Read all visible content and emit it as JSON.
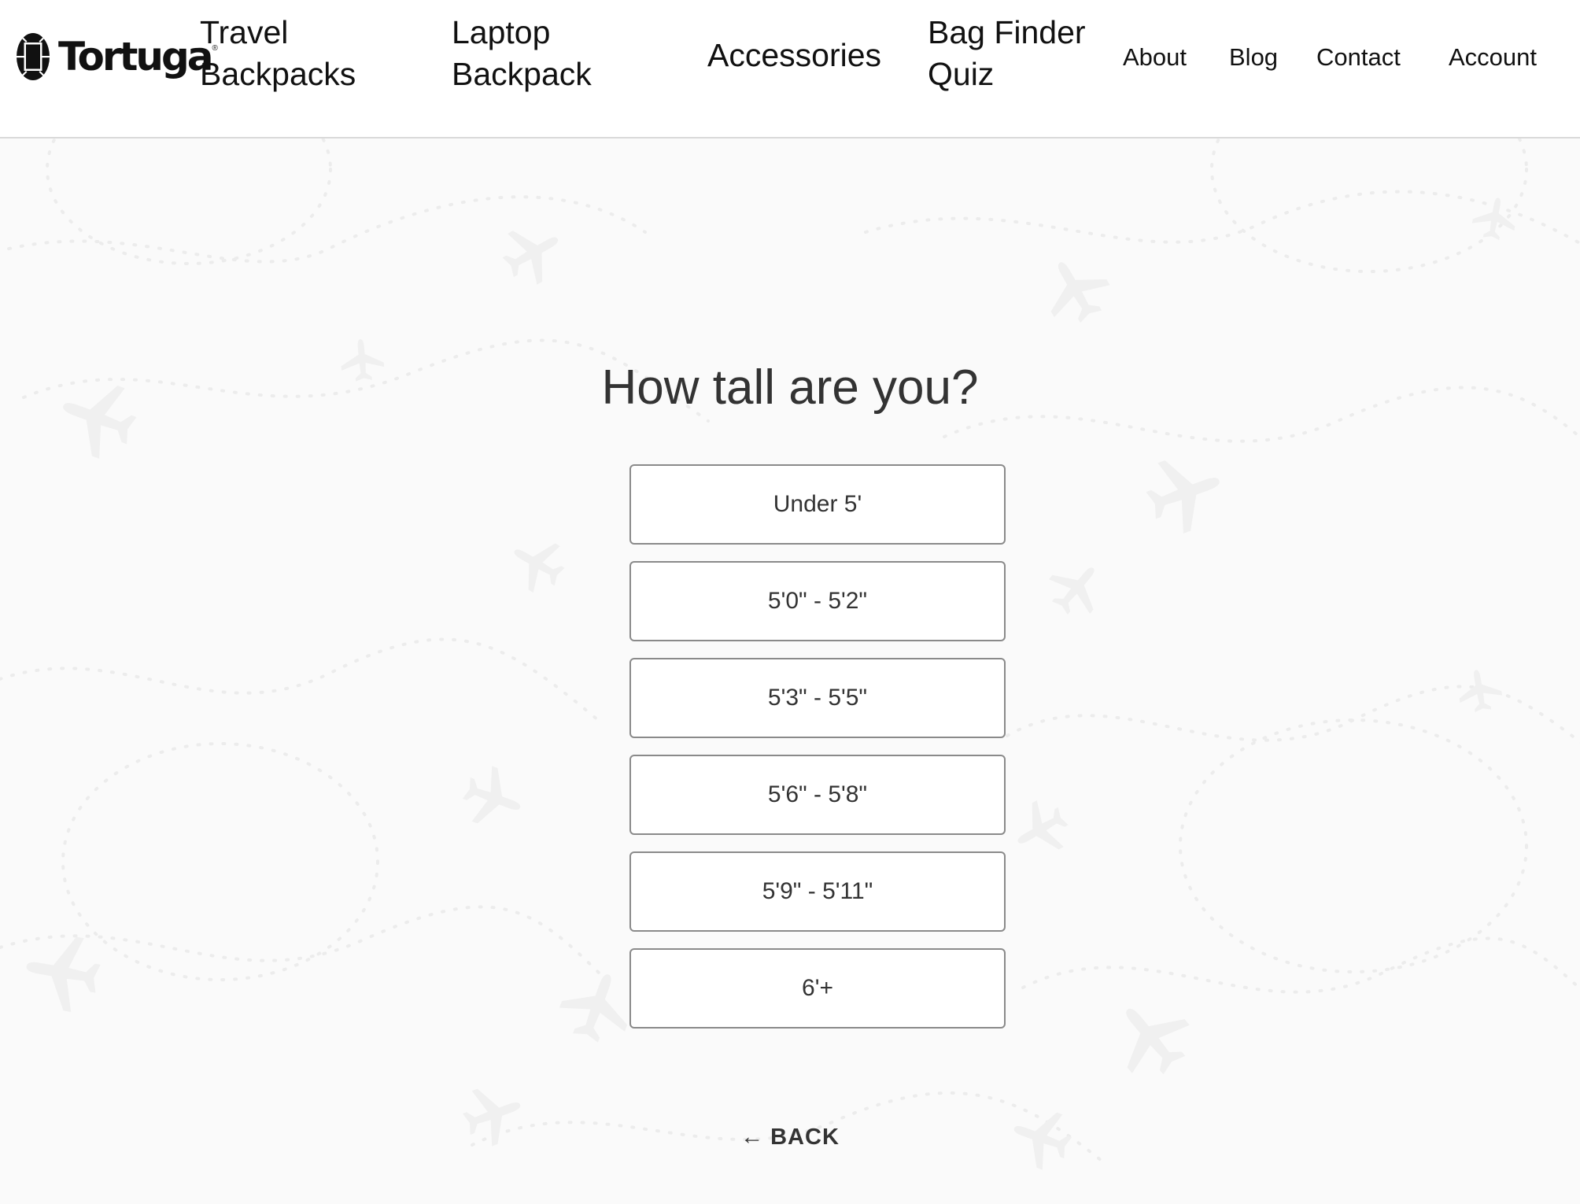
{
  "header": {
    "logo": {
      "wordmark": "Tortuga",
      "registered": "®",
      "icon": "turtle-shell-icon"
    },
    "nav_primary": [
      {
        "label": "Travel\nBackpacks"
      },
      {
        "label": "Laptop\nBackpack"
      },
      {
        "label": "Accessories"
      },
      {
        "label": "Bag Finder\nQuiz"
      }
    ],
    "nav_secondary": [
      {
        "label": "About"
      },
      {
        "label": "Blog"
      },
      {
        "label": "Contact"
      },
      {
        "label": "Account"
      }
    ]
  },
  "quiz": {
    "question": "How tall are you?",
    "options": [
      {
        "label": "Under 5'"
      },
      {
        "label": "5'0\" - 5'2\""
      },
      {
        "label": "5'3\" - 5'5\""
      },
      {
        "label": "5'6\" - 5'8\""
      },
      {
        "label": "5'9\" - 5'11\""
      },
      {
        "label": "6'+"
      }
    ],
    "back": {
      "arrow": "←",
      "label": "BACK"
    }
  },
  "colors": {
    "page_background": "#fafafa",
    "header_background": "#ffffff",
    "header_border": "#d9d9d9",
    "text_primary": "#111111",
    "text_secondary": "#333333",
    "option_border": "#8a8a8a"
  }
}
